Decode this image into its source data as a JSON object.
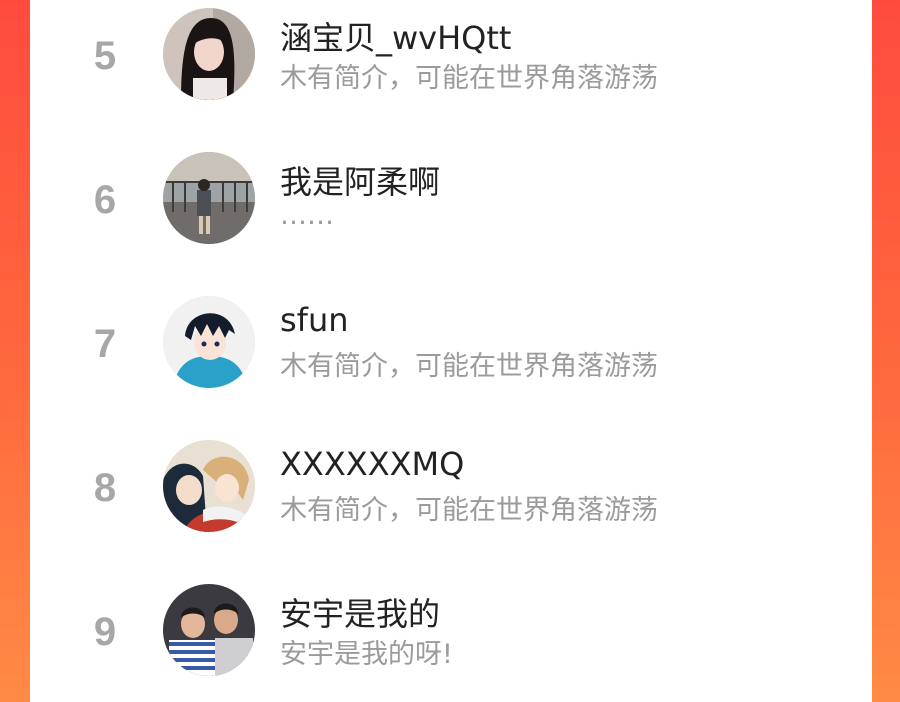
{
  "leaderboard": {
    "rows": [
      {
        "rank": "5",
        "name": "涵宝贝_wvHQtt",
        "bio": "木有简介，可能在世界角落游荡",
        "avatar_icon": "avatar-girl-photo"
      },
      {
        "rank": "6",
        "name": "我是阿柔啊",
        "bio": "……",
        "avatar_icon": "avatar-street-photo"
      },
      {
        "rank": "7",
        "name": "sfun",
        "bio": "木有简介，可能在世界角落游荡",
        "avatar_icon": "avatar-anime-boy"
      },
      {
        "rank": "8",
        "name": "XXXXXXMQ",
        "bio": "木有简介，可能在世界角落游荡",
        "avatar_icon": "avatar-anime-couple"
      },
      {
        "rank": "9",
        "name": "安宇是我的",
        "bio": "安宇是我的呀!",
        "avatar_icon": "avatar-two-boys-photo"
      }
    ]
  },
  "colors": {
    "background_top": "#ff4b3e",
    "background_bottom": "#ff8a45",
    "rank_text": "#a7a7a7",
    "name_text": "#222222",
    "bio_text": "#9b9b9b"
  }
}
